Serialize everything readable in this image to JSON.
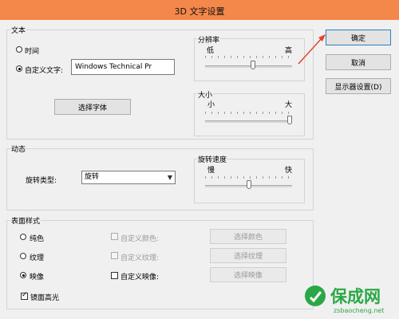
{
  "window": {
    "title": "3D 文字设置"
  },
  "text_group": {
    "label": "文本",
    "radio_time": "时间",
    "radio_custom": "自定义文字:",
    "custom_text_value": "Windows Technical Pr",
    "choose_font_button": "选择字体",
    "resolution": {
      "label": "分辨率",
      "min_label": "低",
      "max_label": "高",
      "value": 0.55
    },
    "size": {
      "label": "大小",
      "min_label": "小",
      "max_label": "大",
      "value": 1.0
    }
  },
  "motion_group": {
    "label": "动态",
    "rotation_type_label": "旋转类型:",
    "rotation_type_value": "旋转",
    "speed": {
      "label": "旋转速度",
      "min_label": "慢",
      "max_label": "快",
      "value": 0.5
    }
  },
  "surface_group": {
    "label": "表面样式",
    "options": [
      {
        "label": "纯色",
        "selected": false
      },
      {
        "label": "纹理",
        "selected": false
      },
      {
        "label": "映像",
        "selected": true
      }
    ],
    "custom_checks": [
      {
        "label": "自定义颜色:",
        "enabled": false
      },
      {
        "label": "自定义纹理:",
        "enabled": false
      },
      {
        "label": "自定义映像:",
        "enabled": true
      }
    ],
    "buttons": [
      "选择颜色",
      "选择纹理",
      "选择映像"
    ],
    "specular_label": "镜面高光",
    "specular_checked": true
  },
  "side_buttons": {
    "ok": "确定",
    "cancel": "取消",
    "display": "显示器设置(D)"
  },
  "watermark": {
    "main": "保成网",
    "url": "zsbaocheng.net"
  },
  "colors": {
    "titlebar": "#f4874a",
    "arrow": "#e8412c",
    "watermark_green": "#2aa845"
  }
}
